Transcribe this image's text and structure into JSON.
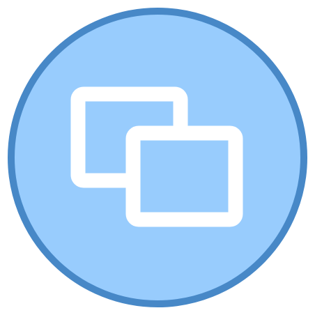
{
  "icon": {
    "name": "restore-windows-icon",
    "colors": {
      "background": "#ffffff",
      "circle_fill": "#98ccfd",
      "circle_stroke": "#4788c7",
      "window_fill": "#98ccfd",
      "window_stroke": "#ffffff"
    }
  }
}
